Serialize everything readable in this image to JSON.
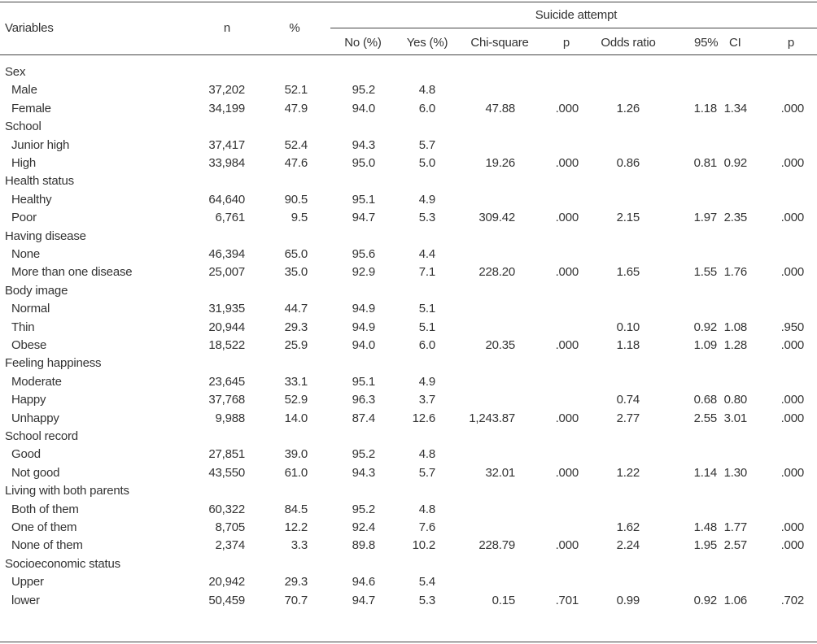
{
  "header": {
    "variables": "Variables",
    "n": "n",
    "pct": "%",
    "suicide_attempt": "Suicide attempt",
    "no": "No (%)",
    "yes": "Yes (%)",
    "chi": "Chi-square",
    "p": "p",
    "odds": "Odds ratio",
    "ci95": "95%",
    "ci": "CI",
    "p2": "p"
  },
  "rows": [
    {
      "type": "group",
      "label": "Sex"
    },
    {
      "type": "item",
      "label": "Male",
      "n": "37,202",
      "pct": "52.1",
      "no": "95.2",
      "yes": "4.8",
      "chi": "",
      "p": "",
      "or": "",
      "ci_lo": "",
      "ci_hi": "",
      "p2": ""
    },
    {
      "type": "item",
      "label": "Female",
      "n": "34,199",
      "pct": "47.9",
      "no": "94.0",
      "yes": "6.0",
      "chi": "47.88",
      "p": ".000",
      "or": "1.26",
      "ci_lo": "1.18",
      "ci_hi": "1.34",
      "p2": ".000"
    },
    {
      "type": "group",
      "label": "School"
    },
    {
      "type": "item",
      "label": "Junior high",
      "n": "37,417",
      "pct": "52.4",
      "no": "94.3",
      "yes": "5.7",
      "chi": "",
      "p": "",
      "or": "",
      "ci_lo": "",
      "ci_hi": "",
      "p2": ""
    },
    {
      "type": "item",
      "label": "High",
      "n": "33,984",
      "pct": "47.6",
      "no": "95.0",
      "yes": "5.0",
      "chi": "19.26",
      "p": ".000",
      "or": "0.86",
      "ci_lo": "0.81",
      "ci_hi": "0.92",
      "p2": ".000"
    },
    {
      "type": "group",
      "label": "Health status"
    },
    {
      "type": "item",
      "label": "Healthy",
      "n": "64,640",
      "pct": "90.5",
      "no": "95.1",
      "yes": "4.9",
      "chi": "",
      "p": "",
      "or": "",
      "ci_lo": "",
      "ci_hi": "",
      "p2": ""
    },
    {
      "type": "item",
      "label": "Poor",
      "n": "6,761",
      "pct": "9.5",
      "no": "94.7",
      "yes": "5.3",
      "chi": "309.42",
      "p": ".000",
      "or": "2.15",
      "ci_lo": "1.97",
      "ci_hi": "2.35",
      "p2": ".000"
    },
    {
      "type": "group",
      "label": "Having disease"
    },
    {
      "type": "item",
      "label": "None",
      "n": "46,394",
      "pct": "65.0",
      "no": "95.6",
      "yes": "4.4",
      "chi": "",
      "p": "",
      "or": "",
      "ci_lo": "",
      "ci_hi": "",
      "p2": ""
    },
    {
      "type": "item",
      "label": "More than one disease",
      "n": "25,007",
      "pct": "35.0",
      "no": "92.9",
      "yes": "7.1",
      "chi": "228.20",
      "p": ".000",
      "or": "1.65",
      "ci_lo": "1.55",
      "ci_hi": "1.76",
      "p2": ".000"
    },
    {
      "type": "group",
      "label": "Body image"
    },
    {
      "type": "item",
      "label": "Normal",
      "n": "31,935",
      "pct": "44.7",
      "no": "94.9",
      "yes": "5.1",
      "chi": "",
      "p": "",
      "or": "",
      "ci_lo": "",
      "ci_hi": "",
      "p2": ""
    },
    {
      "type": "item",
      "label": "Thin",
      "n": "20,944",
      "pct": "29.3",
      "no": "94.9",
      "yes": "5.1",
      "chi": "",
      "p": "",
      "or": "0.10",
      "ci_lo": "0.92",
      "ci_hi": "1.08",
      "p2": ".950"
    },
    {
      "type": "item",
      "label": "Obese",
      "n": "18,522",
      "pct": "25.9",
      "no": "94.0",
      "yes": "6.0",
      "chi": "20.35",
      "p": ".000",
      "or": "1.18",
      "ci_lo": "1.09",
      "ci_hi": "1.28",
      "p2": ".000"
    },
    {
      "type": "group",
      "label": "Feeling happiness"
    },
    {
      "type": "item",
      "label": "Moderate",
      "n": "23,645",
      "pct": "33.1",
      "no": "95.1",
      "yes": "4.9",
      "chi": "",
      "p": "",
      "or": "",
      "ci_lo": "",
      "ci_hi": "",
      "p2": ""
    },
    {
      "type": "item",
      "label": "Happy",
      "n": "37,768",
      "pct": "52.9",
      "no": "96.3",
      "yes": "3.7",
      "chi": "",
      "p": "",
      "or": "0.74",
      "ci_lo": "0.68",
      "ci_hi": "0.80",
      "p2": ".000"
    },
    {
      "type": "item",
      "label": "Unhappy",
      "n": "9,988",
      "pct": "14.0",
      "no": "87.4",
      "yes": "12.6",
      "chi": "1,243.87",
      "p": ".000",
      "or": "2.77",
      "ci_lo": "2.55",
      "ci_hi": "3.01",
      "p2": ".000"
    },
    {
      "type": "group",
      "label": "School record"
    },
    {
      "type": "item",
      "label": "Good",
      "n": "27,851",
      "pct": "39.0",
      "no": "95.2",
      "yes": "4.8",
      "chi": "",
      "p": "",
      "or": "",
      "ci_lo": "",
      "ci_hi": "",
      "p2": ""
    },
    {
      "type": "item",
      "label": "Not good",
      "n": "43,550",
      "pct": "61.0",
      "no": "94.3",
      "yes": "5.7",
      "chi": "32.01",
      "p": ".000",
      "or": "1.22",
      "ci_lo": "1.14",
      "ci_hi": "1.30",
      "p2": ".000"
    },
    {
      "type": "group",
      "label": "Living with both parents"
    },
    {
      "type": "item",
      "label": "Both of them",
      "n": "60,322",
      "pct": "84.5",
      "no": "95.2",
      "yes": "4.8",
      "chi": "",
      "p": "",
      "or": "",
      "ci_lo": "",
      "ci_hi": "",
      "p2": ""
    },
    {
      "type": "item",
      "label": "One of them",
      "n": "8,705",
      "pct": "12.2",
      "no": "92.4",
      "yes": "7.6",
      "chi": "",
      "p": "",
      "or": "1.62",
      "ci_lo": "1.48",
      "ci_hi": "1.77",
      "p2": ".000"
    },
    {
      "type": "item",
      "label": "None of them",
      "n": "2,374",
      "pct": "3.3",
      "no": "89.8",
      "yes": "10.2",
      "chi": "228.79",
      "p": ".000",
      "or": "2.24",
      "ci_lo": "1.95",
      "ci_hi": "2.57",
      "p2": ".000"
    },
    {
      "type": "group",
      "label": "Socioeconomic status"
    },
    {
      "type": "item",
      "label": "Upper",
      "n": "20,942",
      "pct": "29.3",
      "no": "94.6",
      "yes": "5.4",
      "chi": "",
      "p": "",
      "or": "",
      "ci_lo": "",
      "ci_hi": "",
      "p2": ""
    },
    {
      "type": "item",
      "label": "lower",
      "n": "50,459",
      "pct": "70.7",
      "no": "94.7",
      "yes": "5.3",
      "chi": "0.15",
      "p": ".701",
      "or": "0.99",
      "ci_lo": "0.92",
      "ci_hi": "1.06",
      "p2": ".702"
    }
  ]
}
